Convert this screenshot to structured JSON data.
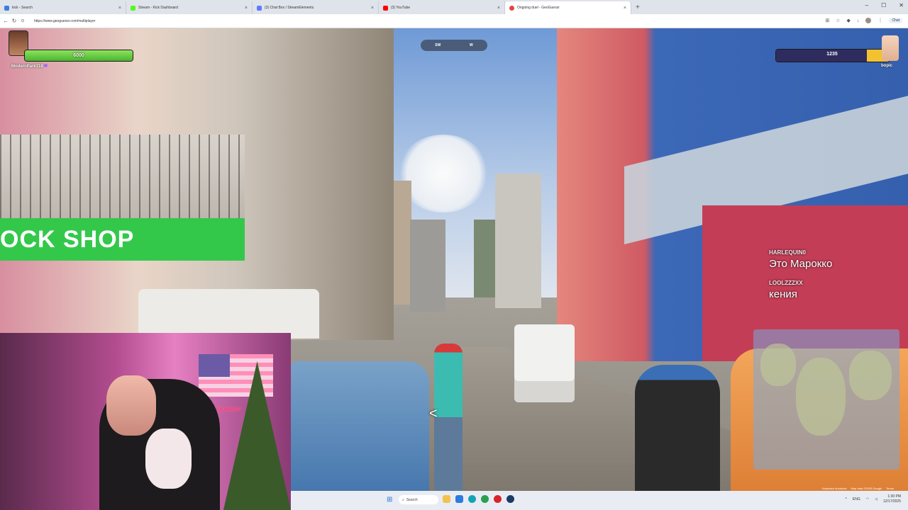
{
  "browser": {
    "tabs": [
      {
        "title": "kick - Search",
        "icon": "search-icon",
        "color": "#3b7ddd"
      },
      {
        "title": "Stream - Kick Dashboard",
        "icon": "kick-icon",
        "color": "#53fc18"
      },
      {
        "title": "(3) Chat Box / StreamElements",
        "icon": "streamelements-icon",
        "color": "#5b7cfa"
      },
      {
        "title": "(3) YouTube",
        "icon": "youtube-icon",
        "color": "#ff0000"
      },
      {
        "title": "Ongoing duel - GeoGuessr",
        "icon": "geoguessr-icon",
        "color": "#e04646",
        "active": true
      }
    ],
    "new_tab": "+",
    "url": "https://www.geoguessr.com/multiplayer",
    "chat_button": "Chat",
    "window_controls": [
      "–",
      "☐",
      "✕"
    ]
  },
  "game": {
    "compass": [
      "SW",
      "W"
    ],
    "player1": {
      "name": "ModernPark318",
      "health": 6000,
      "health_fraction": 1.0,
      "bar_color": "#58c83a"
    },
    "player2": {
      "name": "bopic",
      "health": 1235,
      "health_fraction": 0.2,
      "bar_color": "#f2c230"
    },
    "back_arrow": "<",
    "map_footer": [
      "Keyboard shortcuts",
      "Map data ©2025 Google",
      "Terms"
    ]
  },
  "chat": [
    {
      "user": "HARLEQUIN0",
      "message": "Это Марокко"
    },
    {
      "user": "LOOLZZZXX",
      "message": "кения"
    }
  ],
  "scene_text": {
    "shop_sign": "OCK   SHOP",
    "neon": "KOLYANKO?"
  },
  "taskbar": {
    "search_placeholder": "Search",
    "apps": [
      {
        "name": "file-explorer-icon",
        "color": "#f2c14e"
      },
      {
        "name": "photos-icon",
        "color": "#2d7be0"
      },
      {
        "name": "edge-icon",
        "color": "#17a3b5"
      },
      {
        "name": "chrome-icon",
        "color": "#2e9e52"
      },
      {
        "name": "opera-icon",
        "color": "#d8232a"
      },
      {
        "name": "steam-icon",
        "color": "#1a3b66"
      }
    ],
    "lang": "ENG",
    "time": "1:30 PM",
    "date": "12/17/2025"
  }
}
